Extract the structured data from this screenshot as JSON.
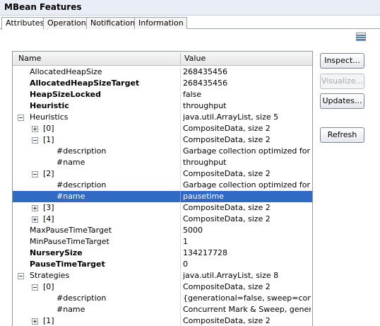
{
  "panel": {
    "title": "MBean Features"
  },
  "tabs": [
    "Attributes",
    "Operations",
    "Notifications",
    "Information"
  ],
  "table": {
    "columns": {
      "name": "Name",
      "value": "Value"
    },
    "rows": [
      {
        "name": "AllocatedHeapSize",
        "value": "268435456",
        "bold": false,
        "indent": 0,
        "twisty": ""
      },
      {
        "name": "AllocatedHeapSizeTarget",
        "value": "268435456",
        "bold": true,
        "indent": 0,
        "twisty": ""
      },
      {
        "name": "HeapSizeLocked",
        "value": "false",
        "bold": true,
        "indent": 0,
        "twisty": ""
      },
      {
        "name": "Heuristic",
        "value": "throughput",
        "bold": true,
        "indent": 0,
        "twisty": ""
      },
      {
        "name": "Heuristics",
        "value": "java.util.ArrayList, size 5",
        "bold": false,
        "indent": 0,
        "twisty": "minus"
      },
      {
        "name": "[0]",
        "value": "CompositeData, size 2",
        "bold": false,
        "indent": 1,
        "twisty": "plus"
      },
      {
        "name": "[1]",
        "value": "CompositeData, size 2",
        "bold": false,
        "indent": 1,
        "twisty": "minus"
      },
      {
        "name": "#description",
        "value": "Garbage collection optimized for th...",
        "bold": false,
        "indent": 2,
        "twisty": ""
      },
      {
        "name": "#name",
        "value": "throughput",
        "bold": false,
        "indent": 2,
        "twisty": ""
      },
      {
        "name": "[2]",
        "value": "CompositeData, size 2",
        "bold": false,
        "indent": 1,
        "twisty": "minus"
      },
      {
        "name": "#description",
        "value": "Garbage collection optimized for sh...",
        "bold": false,
        "indent": 2,
        "twisty": ""
      },
      {
        "name": "#name",
        "value": "pausetime",
        "bold": false,
        "indent": 2,
        "twisty": "",
        "selected": true
      },
      {
        "name": "[3]",
        "value": "CompositeData, size 2",
        "bold": false,
        "indent": 1,
        "twisty": "plus"
      },
      {
        "name": "[4]",
        "value": "CompositeData, size 2",
        "bold": false,
        "indent": 1,
        "twisty": "plus"
      },
      {
        "name": "MaxPauseTimeTarget",
        "value": "5000",
        "bold": false,
        "indent": 0,
        "twisty": ""
      },
      {
        "name": "MinPauseTimeTarget",
        "value": "1",
        "bold": false,
        "indent": 0,
        "twisty": ""
      },
      {
        "name": "NurserySize",
        "value": "134217728",
        "bold": true,
        "indent": 0,
        "twisty": ""
      },
      {
        "name": "PauseTimeTarget",
        "value": "0",
        "bold": true,
        "indent": 0,
        "twisty": ""
      },
      {
        "name": "Strategies",
        "value": "java.util.ArrayList, size 8",
        "bold": false,
        "indent": 0,
        "twisty": "minus"
      },
      {
        "name": "[0]",
        "value": "CompositeData, size 2",
        "bold": false,
        "indent": 1,
        "twisty": "minus"
      },
      {
        "name": "#description",
        "value": "{generational=false, sweep=conc...",
        "bold": false,
        "indent": 2,
        "twisty": ""
      },
      {
        "name": "#name",
        "value": "Concurrent Mark & Sweep, genera...",
        "bold": false,
        "indent": 2,
        "twisty": ""
      },
      {
        "name": "[1]",
        "value": "CompositeData, size 2",
        "bold": false,
        "indent": 1,
        "twisty": "plus"
      }
    ]
  },
  "buttons": {
    "inspect": "Inspect...",
    "visualize": "Visualize...",
    "updates": "Updates...",
    "refresh": "Refresh"
  },
  "icons": {
    "view_menu": "view-menu-icon"
  },
  "colors": {
    "selection": "#316ac5",
    "header_bg": "#e9eef6"
  }
}
